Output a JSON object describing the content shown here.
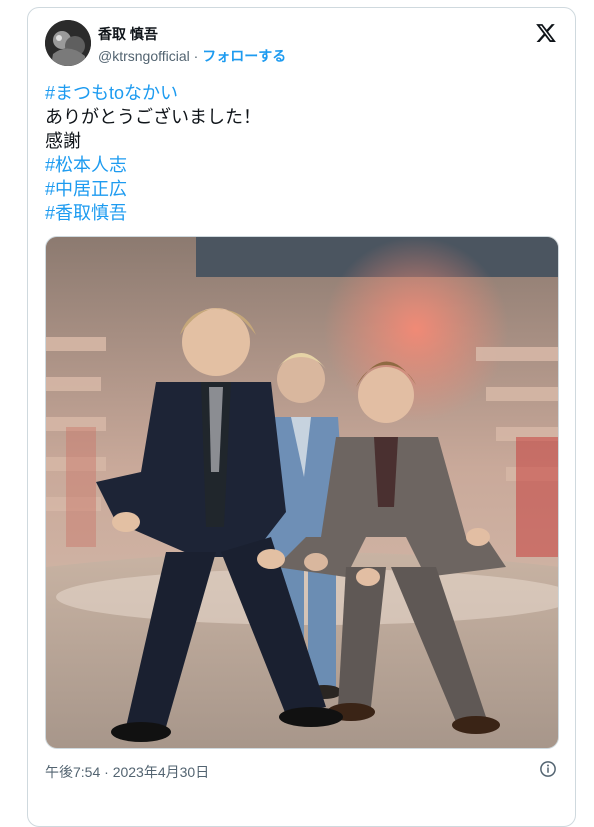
{
  "author": {
    "name": "香取 慎吾",
    "handle": "@ktrsngofficial",
    "separator": " · ",
    "follow_label": "フォローする"
  },
  "post": {
    "lines": [
      {
        "text": "#まつもtoなかい",
        "hashtag": true
      },
      {
        "text": "ありがとうございました！",
        "hashtag": false
      },
      {
        "text": "感謝",
        "hashtag": false
      },
      {
        "text": "#松本人志",
        "hashtag": true
      },
      {
        "text": "#中居正広",
        "hashtag": true
      },
      {
        "text": "#香取慎吾",
        "hashtag": true
      }
    ],
    "timestamp": "午後7:54 · 2023年4月30日"
  },
  "icons": {
    "platform_logo": "x-logo-icon",
    "info": "info-icon",
    "avatar": "avatar"
  }
}
